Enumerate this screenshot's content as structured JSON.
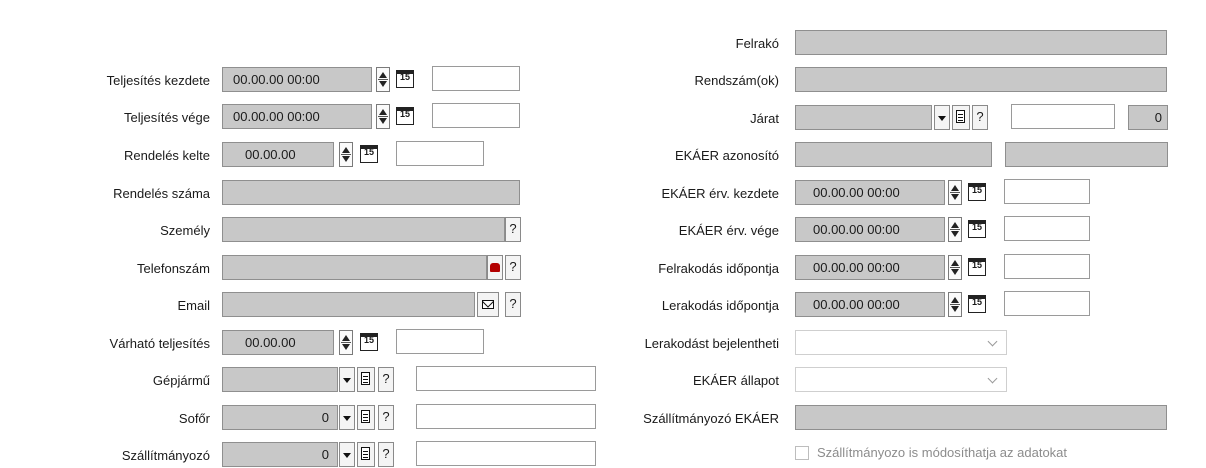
{
  "left": {
    "teljesites_kezdete": {
      "label": "Teljesítés kezdete",
      "value": "00.00.00 00:00"
    },
    "teljesites_vege": {
      "label": "Teljesítés vége",
      "value": "00.00.00 00:00"
    },
    "rendeles_kelte": {
      "label": "Rendelés kelte",
      "value": "00.00.00"
    },
    "rendeles_szama": {
      "label": "Rendelés száma",
      "value": ""
    },
    "szemely": {
      "label": "Személy",
      "help": "?"
    },
    "telefonszam": {
      "label": "Telefonszám",
      "help": "?"
    },
    "email": {
      "label": "Email",
      "help": "?"
    },
    "varhato_teljesites": {
      "label": "Várható teljesítés",
      "value": "00.00.00"
    },
    "gepjarmu": {
      "label": "Gépjármű",
      "value": "",
      "help": "?"
    },
    "sofor": {
      "label": "Sofőr",
      "value": "0",
      "help": "?"
    },
    "szallitmanyozo": {
      "label": "Szállítmányozó",
      "value": "0",
      "help": "?"
    }
  },
  "right": {
    "felrako": {
      "label": "Felrakó"
    },
    "rendszamok": {
      "label": "Rendszám(ok)"
    },
    "jarat": {
      "label": "Járat",
      "help": "?",
      "count": "0"
    },
    "ekaer_azonosito": {
      "label": "EKÁER azonosító"
    },
    "ekaer_erv_kezdete": {
      "label": "EKÁER érv. kezdete",
      "value": "00.00.00 00:00"
    },
    "ekaer_erv_vege": {
      "label": "EKÁER érv. vége",
      "value": "00.00.00 00:00"
    },
    "felrakodas_idopontja": {
      "label": "Felrakodás időpontja",
      "value": "00.00.00 00:00"
    },
    "lerakodas_idopontja": {
      "label": "Lerakodás időpontja",
      "value": "00.00.00 00:00"
    },
    "lerakodast_bejelentheti": {
      "label": "Lerakodást bejelentheti"
    },
    "ekaer_allapot": {
      "label": "EKÁER állapot"
    },
    "szallitmanyozo_ekaer": {
      "label": "Szállítmányozó EKÁER"
    },
    "checkbox": {
      "label": "Szállítmányozo is módosíthatja az adatokat"
    }
  },
  "calendar_glyph": "15"
}
